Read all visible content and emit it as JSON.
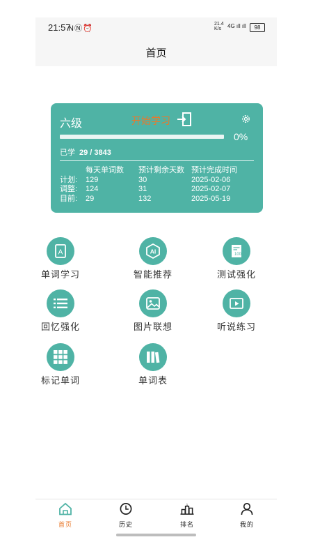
{
  "status_bar": {
    "time": "21:57",
    "icons": "NⓃ⏰",
    "net_speed": "21.4",
    "net_unit": "K/s",
    "signal": "4G ıll ıll",
    "battery": "98"
  },
  "header": {
    "title": "首页"
  },
  "card": {
    "level": "六级",
    "start_label": "开始学习",
    "progress_fraction": 0.0,
    "progress_text": "0%",
    "learned_label": "已学",
    "learned_value": "29 / 3843",
    "table": {
      "headers": [
        "",
        "每天单词数",
        "预计剩余天数",
        "预计完成时间"
      ],
      "rows": [
        [
          "计划:",
          "129",
          "30",
          "2025-02-06"
        ],
        [
          "调整:",
          "124",
          "31",
          "2025-02-07"
        ],
        [
          "目前:",
          "29",
          "132",
          "2025-05-19"
        ]
      ]
    }
  },
  "features": [
    {
      "label": "单词学习",
      "icon": "letter-a-book-icon"
    },
    {
      "label": "智能推荐",
      "icon": "ai-badge-icon"
    },
    {
      "label": "测试强化",
      "icon": "test-paper-icon"
    },
    {
      "label": "回忆强化",
      "icon": "list-icon"
    },
    {
      "label": "图片联想",
      "icon": "image-icon"
    },
    {
      "label": "听说练习",
      "icon": "video-play-icon"
    },
    {
      "label": "标记单词",
      "icon": "grid-icon"
    },
    {
      "label": "单词表",
      "icon": "books-icon"
    }
  ],
  "tabs": [
    {
      "label": "首页",
      "icon": "home-icon",
      "active": true
    },
    {
      "label": "历史",
      "icon": "clock-icon",
      "active": false
    },
    {
      "label": "排名",
      "icon": "ranking-icon",
      "active": false
    },
    {
      "label": "我的",
      "icon": "person-icon",
      "active": false
    }
  ],
  "colors": {
    "accent": "#4fb3a5",
    "highlight": "#e8792c"
  }
}
